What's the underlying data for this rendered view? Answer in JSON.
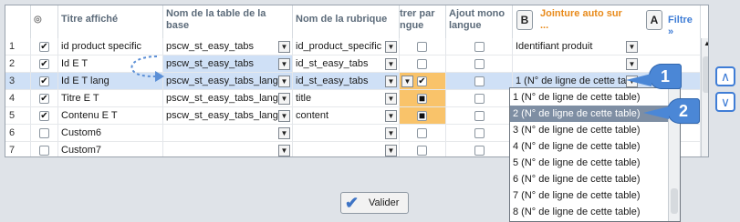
{
  "headers": {
    "titre": "Titre affiché",
    "table_line1": "Nom de la table de la",
    "table_line2": "base",
    "rubrique": "Nom de la rubrique",
    "trier_line1": "trer par",
    "trier_line2": "ngue",
    "ajout_line1": "Ajout mono",
    "ajout_line2": "langue",
    "b_letter": "B",
    "jointure_line1": "Jointure auto sur",
    "jointure_line2": "...",
    "a_letter": "A",
    "filtre": "Filtre"
  },
  "rows": [
    {
      "num": "1",
      "checked": "✔",
      "titre": "id product specific",
      "table": "pscw_st_easy_tabs",
      "rubrique": "id_product_specific",
      "jointure": "Identifiant produit"
    },
    {
      "num": "2",
      "checked": "✔",
      "titre": "Id E T",
      "table": "pscw_st_easy_tabs",
      "rubrique": "id_st_easy_tabs",
      "jointure": ""
    },
    {
      "num": "3",
      "checked": "✔",
      "titre": "Id E T lang",
      "table": "pscw_st_easy_tabs_lang",
      "rubrique": "id_st_easy_tabs",
      "jointure": "1 (N° de ligne de cette tab"
    },
    {
      "num": "4",
      "checked": "✔",
      "titre": "Titre E T",
      "table": "pscw_st_easy_tabs_lang",
      "rubrique": "title",
      "jointure": ""
    },
    {
      "num": "5",
      "checked": "✔",
      "titre": "Contenu E T",
      "table": "pscw_st_easy_tabs_lang",
      "rubrique": "content",
      "jointure": ""
    },
    {
      "num": "6",
      "checked": "",
      "titre": "Custom6",
      "table": "",
      "rubrique": "",
      "jointure": ""
    },
    {
      "num": "7",
      "checked": "",
      "titre": "Custom7",
      "table": "",
      "rubrique": "",
      "jointure": ""
    }
  ],
  "dropdown_options": [
    "1 (N° de ligne de cette table)",
    "2 (N° de ligne de cette table)",
    "3 (N° de ligne de cette table)",
    "4 (N° de ligne de cette table)",
    "5 (N° de ligne de cette table)",
    "6 (N° de ligne de cette table)",
    "7 (N° de ligne de cette table)",
    "8 (N° de ligne de cette table)"
  ],
  "badges": {
    "one": "1",
    "two": "2"
  },
  "valider_label": "Valider",
  "icons": {
    "check": "✔",
    "valider": "✔",
    "dropdown": "▼",
    "filter": "»",
    "up": "∧",
    "down": "∨"
  },
  "colors": {
    "selected_row": "#cfe0f6",
    "orange_cell": "#f9c36a",
    "list_highlight": "#7e8ea3",
    "badge": "#4b87d6",
    "header_orange": "#e88a1a"
  }
}
